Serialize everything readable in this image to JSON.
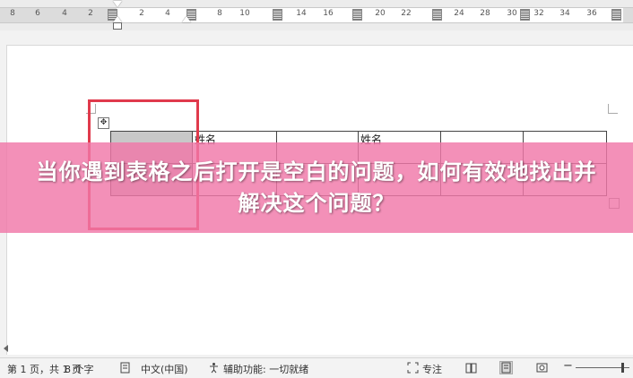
{
  "ruler": {
    "ticks": [
      "8",
      "6",
      "4",
      "2",
      "2",
      "4",
      "8",
      "10",
      "14",
      "16",
      "20",
      "22",
      "24",
      "28",
      "30",
      "32",
      "34",
      "36",
      "38"
    ]
  },
  "table": {
    "row1": {
      "col2": "姓名",
      "col4": "姓名"
    }
  },
  "banner": {
    "text": "当你遇到表格之后打开是空白的问题，如何有效地找出并解决这个问题？"
  },
  "status_bar": {
    "page": "第 1 页，共 1 页",
    "words": "8 个字",
    "language": "中文(中国)",
    "accessibility": "辅助功能: 一切就绪",
    "focus": "专注"
  },
  "colors": {
    "banner": "#f078a8",
    "highlight": "#e03a4c"
  }
}
